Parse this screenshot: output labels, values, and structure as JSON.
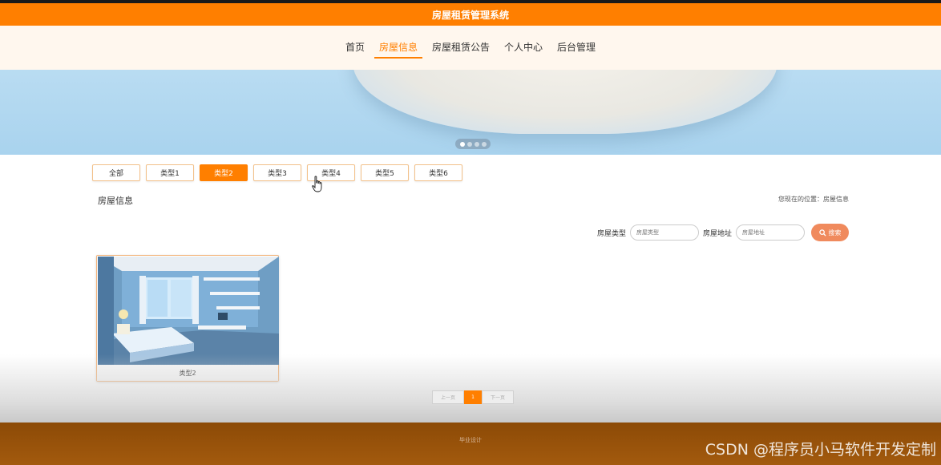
{
  "app": {
    "title": "房屋租赁管理系统"
  },
  "nav": {
    "items": [
      {
        "label": "首页"
      },
      {
        "label": "房屋信息"
      },
      {
        "label": "房屋租赁公告"
      },
      {
        "label": "个人中心"
      },
      {
        "label": "后台管理"
      }
    ],
    "active_index": 1
  },
  "carousel": {
    "slide_count": 4,
    "active_index": 0
  },
  "filter_tabs": {
    "items": [
      {
        "label": "全部"
      },
      {
        "label": "类型1"
      },
      {
        "label": "类型2"
      },
      {
        "label": "类型3"
      },
      {
        "label": "类型4"
      },
      {
        "label": "类型5"
      },
      {
        "label": "类型6"
      }
    ],
    "active_index": 2
  },
  "section": {
    "title": "房屋信息",
    "breadcrumb": "您现在的位置：房屋信息"
  },
  "search": {
    "type_label": "房屋类型",
    "type_placeholder": "房屋类型",
    "address_label": "房屋地址",
    "address_placeholder": "房屋地址",
    "button_label": "搜索"
  },
  "listings": [
    {
      "label": "类型2"
    }
  ],
  "pagination": {
    "prev_label": "上一页",
    "current_page": "1",
    "next_label": "下一页"
  },
  "footer": {
    "text": "毕业设计",
    "watermark": "CSDN @程序员小马软件开发定制"
  },
  "colors": {
    "accent": "#ff7f00",
    "footer": "#8c4a06",
    "search_button": "#f08a5d"
  }
}
